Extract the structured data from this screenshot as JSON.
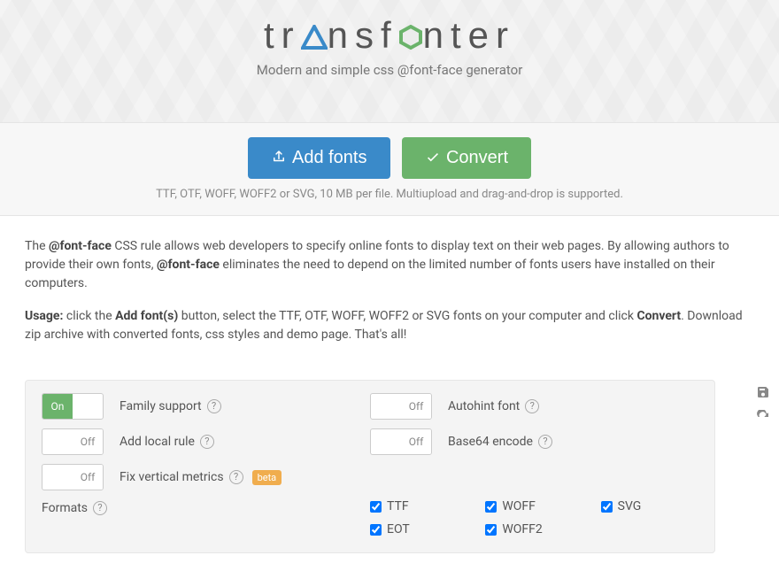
{
  "header": {
    "brand_pre": "tr",
    "brand_mid": "nsf",
    "brand_post": "nter",
    "tagline": "Modern and simple css @font-face generator"
  },
  "actions": {
    "add_fonts": "Add fonts",
    "convert": "Convert",
    "hint": "TTF, OTF, WOFF, WOFF2 or SVG, 10 MB per file. Multiupload and drag-and-drop is supported."
  },
  "prose": {
    "p1a": "The ",
    "p1b": "@font-face",
    "p1c": " CSS rule allows web developers to specify online fonts to display text on their web pages. By allowing authors to provide their own fonts, ",
    "p1d": "@font-face",
    "p1e": " eliminates the need to depend on the limited number of fonts users have installed on their computers.",
    "p2a": "Usage:",
    "p2b": " click the ",
    "p2c": "Add font(s)",
    "p2d": " button, select the TTF, OTF, WOFF, WOFF2 or SVG fonts on your computer and click ",
    "p2e": "Convert",
    "p2f": ". Download zip archive with converted fonts, css styles and demo page. That's all!"
  },
  "options": {
    "on": "On",
    "off": "Off",
    "family_support": "Family support",
    "autohint": "Autohint font",
    "add_local": "Add local rule",
    "base64": "Base64 encode",
    "fix_vert": "Fix vertical metrics",
    "beta": "beta",
    "formats_label": "Formats",
    "formats": {
      "ttf": "TTF",
      "woff": "WOFF",
      "svg": "SVG",
      "eot": "EOT",
      "woff2": "WOFF2"
    }
  }
}
